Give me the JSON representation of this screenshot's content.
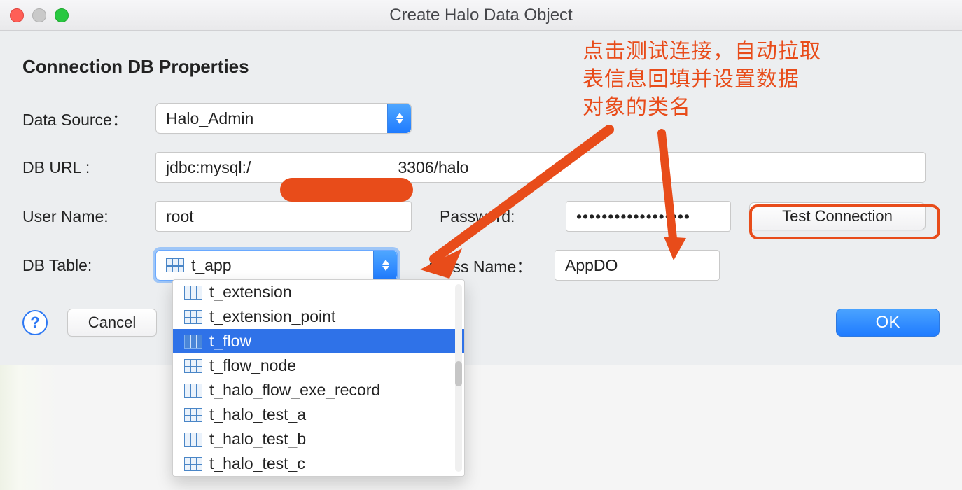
{
  "window": {
    "title": "Create Halo Data Object"
  },
  "section": {
    "title": "Connection DB Properties"
  },
  "labels": {
    "data_source": "Data Source：",
    "db_url": "DB   URL :",
    "user_name": "User Name:",
    "password": "Password:",
    "db_table": "DB  Table:",
    "class_name": "Class Name："
  },
  "fields": {
    "data_source": "Halo_Admin",
    "db_url_prefix": "jdbc:mysql:/",
    "db_url_suffix": "3306/halo",
    "user_name": "root",
    "password_mask": "••••••••••••••••••",
    "db_table": "t_app",
    "class_name": "AppDO"
  },
  "buttons": {
    "test_connection": "Test Connection",
    "cancel": "Cancel",
    "ok": "OK",
    "help": "?"
  },
  "dropdown": {
    "selected": "t_flow",
    "items": [
      "t_extension",
      "t_extension_point",
      "t_flow",
      "t_flow_node",
      "t_halo_flow_exe_record",
      "t_halo_test_a",
      "t_halo_test_b",
      "t_halo_test_c"
    ]
  },
  "annotation": {
    "line1": "点击测试连接，自动拉取",
    "line2": "表信息回填并设置数据",
    "line3": "对象的类名"
  },
  "colors": {
    "accent_red": "#e84c1a",
    "accent_blue": "#1f7bff"
  }
}
